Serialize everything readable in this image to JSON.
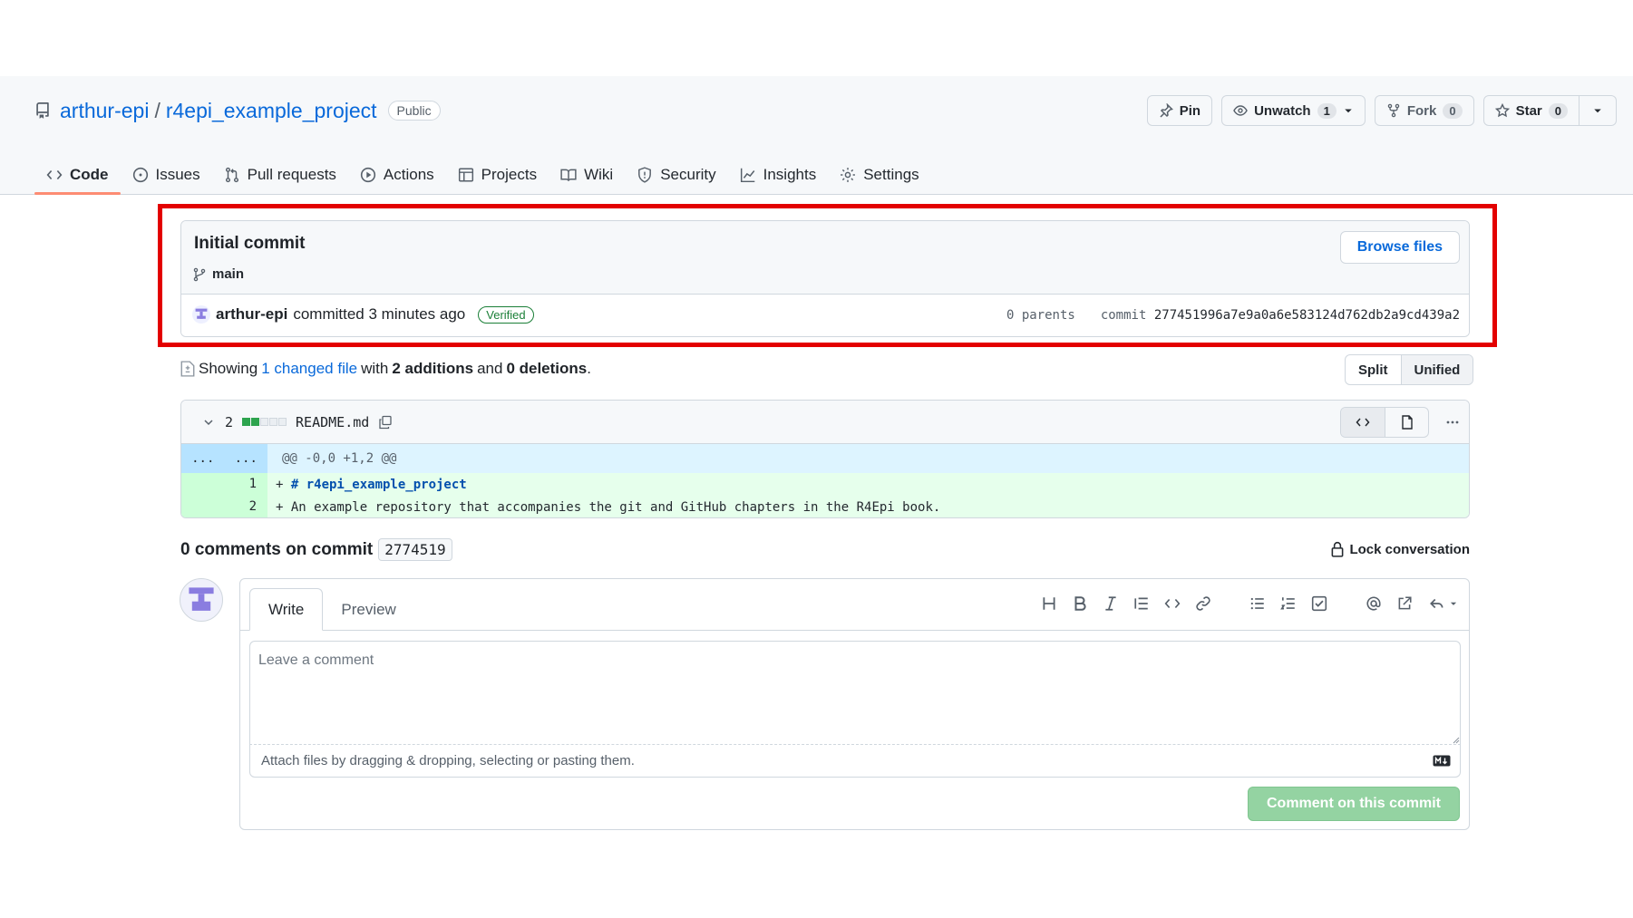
{
  "repo": {
    "owner": "arthur-epi",
    "separator": "/",
    "name": "r4epi_example_project",
    "visibility": "Public"
  },
  "actions": {
    "pin": "Pin",
    "unwatch": "Unwatch",
    "watch_count": "1",
    "fork": "Fork",
    "fork_count": "0",
    "star": "Star",
    "star_count": "0"
  },
  "tabs": [
    {
      "label": "Code",
      "icon": "code-icon"
    },
    {
      "label": "Issues",
      "icon": "issue-icon"
    },
    {
      "label": "Pull requests",
      "icon": "pull-request-icon"
    },
    {
      "label": "Actions",
      "icon": "play-icon"
    },
    {
      "label": "Projects",
      "icon": "table-icon"
    },
    {
      "label": "Wiki",
      "icon": "book-icon"
    },
    {
      "label": "Security",
      "icon": "shield-icon"
    },
    {
      "label": "Insights",
      "icon": "graph-icon"
    },
    {
      "label": "Settings",
      "icon": "gear-icon"
    }
  ],
  "commit": {
    "title": "Initial commit",
    "branch": "main",
    "browse_files": "Browse files",
    "author": "arthur-epi",
    "action": "committed 3 minutes ago",
    "verified": "Verified",
    "parents": "0 parents",
    "commit_label": "commit",
    "sha": "277451996a7e9a0a6e583124d762db2a9cd439a2"
  },
  "summary": {
    "showing": "Showing",
    "changed_files": "1 changed file",
    "with": "with",
    "additions": "2 additions",
    "and": "and",
    "deletions": "0 deletions",
    "period": ".",
    "split": "Split",
    "unified": "Unified"
  },
  "diff": {
    "change_count": "2",
    "filename": "README.md",
    "hunk_left": "...",
    "hunk_right": "...",
    "hunk_header": "@@ -0,0 +1,2 @@",
    "lines": [
      {
        "num": "1",
        "prefix": "+ ",
        "text": "# r4epi_example_project"
      },
      {
        "num": "2",
        "prefix": "+ ",
        "text": "An example repository that accompanies the git and GitHub chapters in the R4Epi book."
      }
    ]
  },
  "comments": {
    "heading": "0 comments on commit",
    "short_sha": "2774519",
    "lock": "Lock conversation",
    "write_tab": "Write",
    "preview_tab": "Preview",
    "placeholder": "Leave a comment",
    "attach_hint": "Attach files by dragging & dropping, selecting or pasting them.",
    "submit": "Comment on this commit"
  },
  "colors": {
    "accent": "#0969da",
    "highlight_border": "#e30000",
    "tab_underline": "#fd8c73",
    "addition_bg": "#e6ffec",
    "submit_disabled": "#94d3a2"
  }
}
